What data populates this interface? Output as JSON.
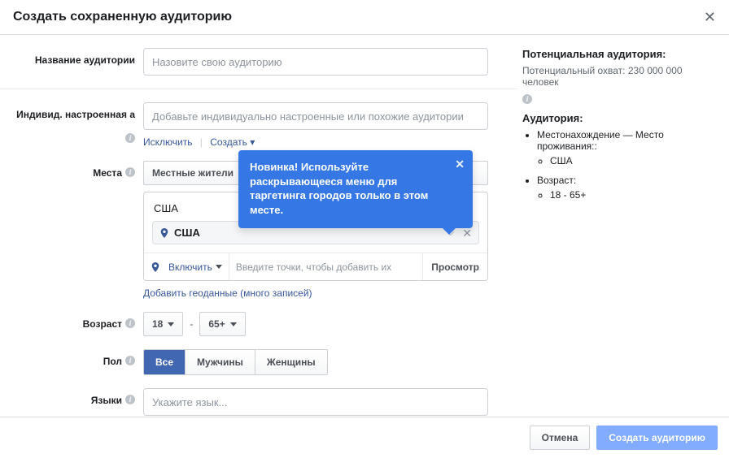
{
  "header": {
    "title": "Создать сохраненную аудиторию"
  },
  "labels": {
    "audience_name": "Название аудитории",
    "custom_audience": "Индивид. настроенная аудитория🛈",
    "locations": "Места",
    "age": "Возраст",
    "gender": "Пол",
    "languages": "Языки"
  },
  "name_field": {
    "placeholder": "Назовите свою аудиторию"
  },
  "custom": {
    "placeholder": "Добавьте индивидуально настроенные или похожие аудитории",
    "exclude": "Исключить",
    "create": "Создать ▾"
  },
  "locations": {
    "residents": "Местные жители",
    "country_group": "США",
    "chip": "США",
    "include": "Включить",
    "input_placeholder": "Введите точки, чтобы добавить их",
    "preview": "Просмотр",
    "bulk_link": "Добавить геоданные (много записей)"
  },
  "tooltip": {
    "text": "Новинка! Используйте раскрывающееся меню для таргетинга городов только в этом месте."
  },
  "age": {
    "min": "18",
    "max": "65+"
  },
  "gender": {
    "all": "Все",
    "male": "Мужчины",
    "female": "Женщины"
  },
  "languages": {
    "placeholder": "Укажите язык..."
  },
  "side": {
    "potential_title": "Потенциальная аудитория:",
    "reach": "Потенциальный охват: 230 000 000 человек",
    "audience_title": "Аудитория:",
    "loc_label": "Местонахождение — Место проживания::",
    "loc_value": "США",
    "age_label": "Возраст:",
    "age_value": "18 - 65+"
  },
  "footer": {
    "cancel": "Отмена",
    "create": "Создать аудиторию"
  }
}
